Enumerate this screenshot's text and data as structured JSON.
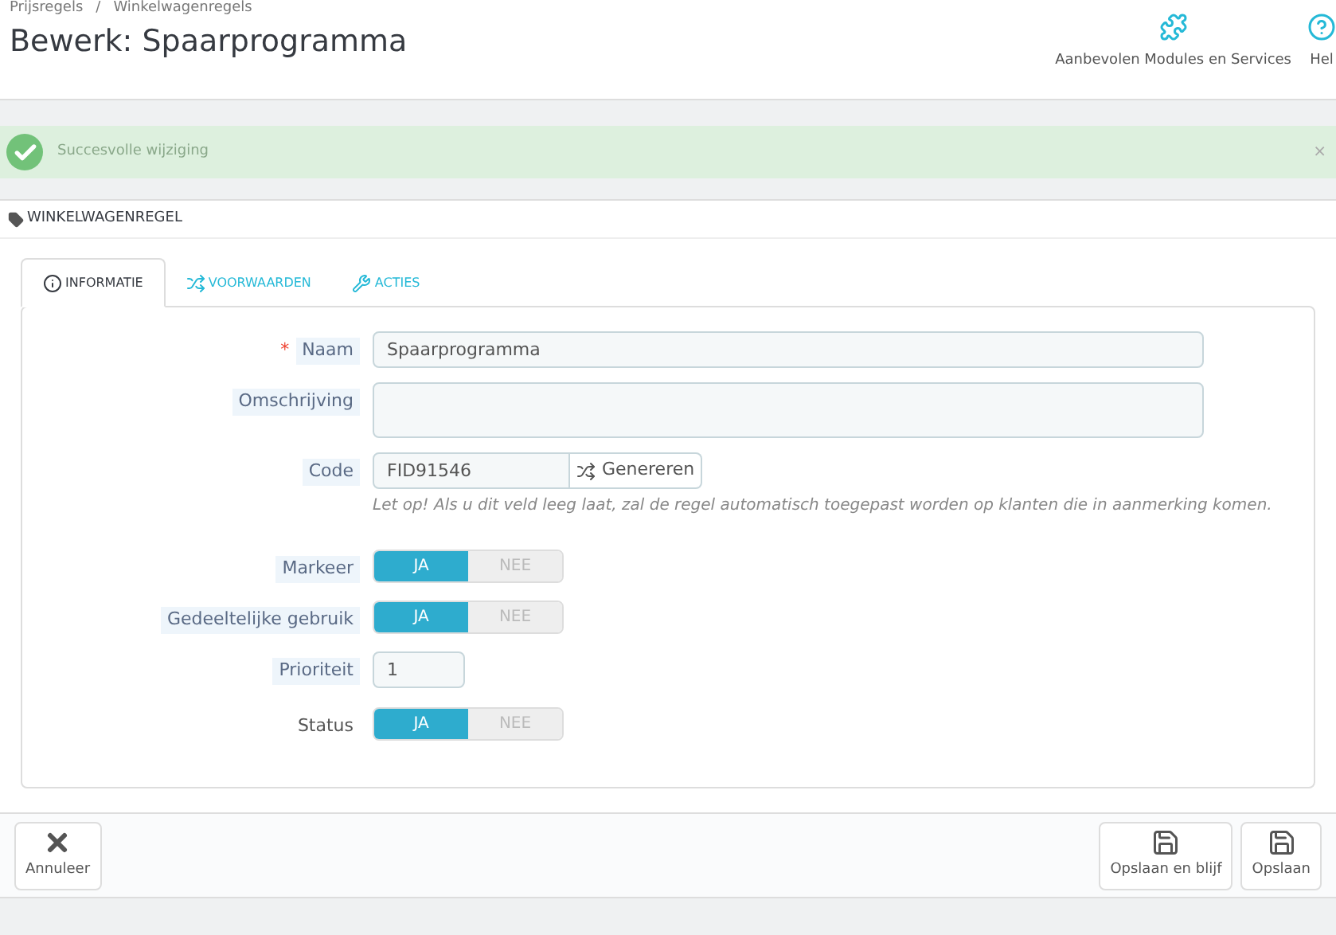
{
  "breadcrumb": [
    "Prijsregels",
    "/",
    "Winkelwagenregels"
  ],
  "title": "Bewerk: Spaarprogramma",
  "toolbar": [
    {
      "kind": "modules",
      "label": "Aanbevolen Modules en Services"
    },
    {
      "kind": "help",
      "label": "Hel"
    }
  ],
  "alert": {
    "message": "Succesvolle wijziging",
    "close": "×"
  },
  "panel": {
    "heading": "WINKELWAGENREGEL"
  },
  "tabs": [
    {
      "kind": "info",
      "label": "INFORMATIE",
      "selected": true
    },
    {
      "kind": "conditions",
      "label": "VOORWAARDEN",
      "selected": false
    },
    {
      "kind": "actions",
      "label": "ACTIES",
      "selected": false
    }
  ],
  "fields": [
    {
      "kind": "text",
      "label": "Naam",
      "required_mark": "*",
      "value": "Spaarprogramma"
    },
    {
      "kind": "textarea",
      "label": "Omschrijving"
    },
    {
      "kind": "code",
      "label": "Code",
      "value": "FID91546",
      "button": "Genereren",
      "help": "Let op! Als u dit veld leeg laat, zal de regel automatisch toegepast worden op klanten die in aanmerking komen."
    },
    {
      "kind": "switch",
      "label": "Markeer",
      "options": [
        {
          "label": "JA",
          "selected": true
        },
        {
          "label": "NEE",
          "selected": false
        }
      ]
    },
    {
      "kind": "switch",
      "label": "Gedeeltelijke gebruik",
      "options": [
        {
          "label": "JA",
          "selected": true
        },
        {
          "label": "NEE",
          "selected": false
        }
      ]
    },
    {
      "kind": "small",
      "label": "Prioriteit",
      "value": "1"
    },
    {
      "kind": "switch",
      "label": "Status",
      "plain": true,
      "options": [
        {
          "label": "JA",
          "selected": true
        },
        {
          "label": "NEE",
          "selected": false
        }
      ]
    }
  ],
  "footer": [
    {
      "kind": "cancel",
      "label": "Annuleer"
    },
    {
      "kind": "save",
      "label": "Opslaan en blijf"
    },
    {
      "kind": "save",
      "label": "Opslaan"
    }
  ]
}
